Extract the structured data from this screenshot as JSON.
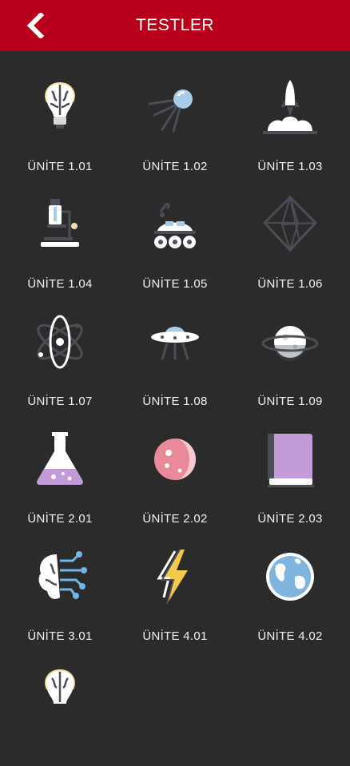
{
  "header": {
    "title": "TESTLER",
    "back_icon": "chevron-left-icon"
  },
  "colors": {
    "header_bg": "#b8001c",
    "page_bg": "#2b2b2c",
    "label": "#f2f2f2"
  },
  "units": [
    {
      "label": "ÜNİTE 1.01",
      "icon": "brain-bulb-icon"
    },
    {
      "label": "ÜNİTE 1.02",
      "icon": "satellite-icon"
    },
    {
      "label": "ÜNİTE 1.03",
      "icon": "rocket-launch-icon"
    },
    {
      "label": "ÜNİTE 1.04",
      "icon": "microscope-icon"
    },
    {
      "label": "ÜNİTE 1.05",
      "icon": "rover-icon"
    },
    {
      "label": "ÜNİTE 1.06",
      "icon": "crystal-icon"
    },
    {
      "label": "ÜNİTE 1.07",
      "icon": "atom-icon"
    },
    {
      "label": "ÜNİTE 1.08",
      "icon": "ufo-icon"
    },
    {
      "label": "ÜNİTE 1.09",
      "icon": "planet-icon"
    },
    {
      "label": "ÜNİTE 2.01",
      "icon": "flask-icon"
    },
    {
      "label": "ÜNİTE 2.02",
      "icon": "moon-icon"
    },
    {
      "label": "ÜNİTE 2.03",
      "icon": "book-icon"
    },
    {
      "label": "ÜNİTE 3.01",
      "icon": "brain-circuit-icon"
    },
    {
      "label": "ÜNİTE 4.01",
      "icon": "lightning-icon"
    },
    {
      "label": "ÜNİTE 4.02",
      "icon": "globe-icon"
    },
    {
      "label": "",
      "icon": "brain-bulb-icon"
    }
  ]
}
